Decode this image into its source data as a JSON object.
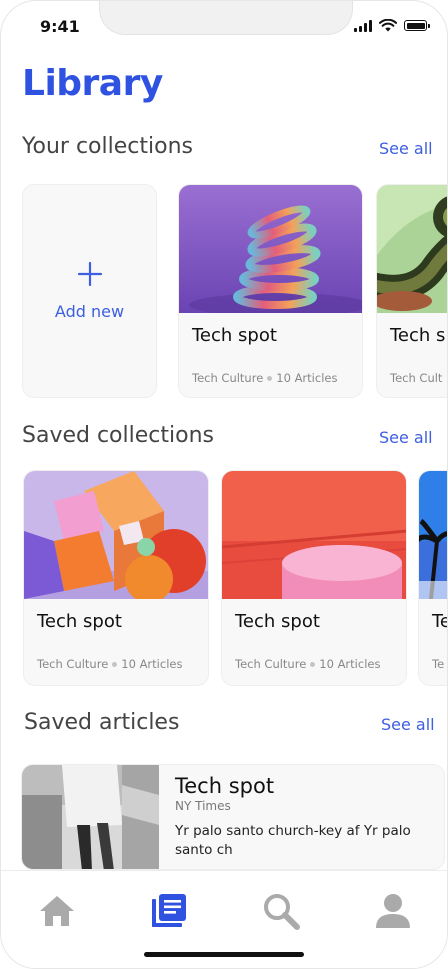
{
  "status_bar": {
    "time": "9:41"
  },
  "page": {
    "title": "Library"
  },
  "your_collections": {
    "title": "Your collections",
    "see_all": "See all",
    "add_new": "Add new",
    "cards": [
      {
        "title": "Tech spot",
        "category": "Tech Culture",
        "count": "10 Articles"
      },
      {
        "title": "Tech sp",
        "category": "Tech Cult"
      }
    ]
  },
  "saved_collections": {
    "title": "Saved collections",
    "see_all": "See all",
    "cards": [
      {
        "title": "Tech spot",
        "category": "Tech Culture",
        "count": "10 Articles"
      },
      {
        "title": "Tech spot",
        "category": "Tech Culture",
        "count": "10 Articles"
      },
      {
        "title": "Te",
        "category": "Te"
      }
    ]
  },
  "saved_articles": {
    "title": "Saved articles",
    "see_all": "See all",
    "items": [
      {
        "title": "Tech spot",
        "source": "NY Times",
        "excerpt": "Yr palo santo church-key af Yr palo santo ch"
      }
    ]
  },
  "tab_bar": {
    "active": "library",
    "accent": "#2f52e0",
    "inactive": "#aaaaaa",
    "items": [
      "home-icon",
      "library-icon",
      "search-icon",
      "profile-icon"
    ]
  }
}
